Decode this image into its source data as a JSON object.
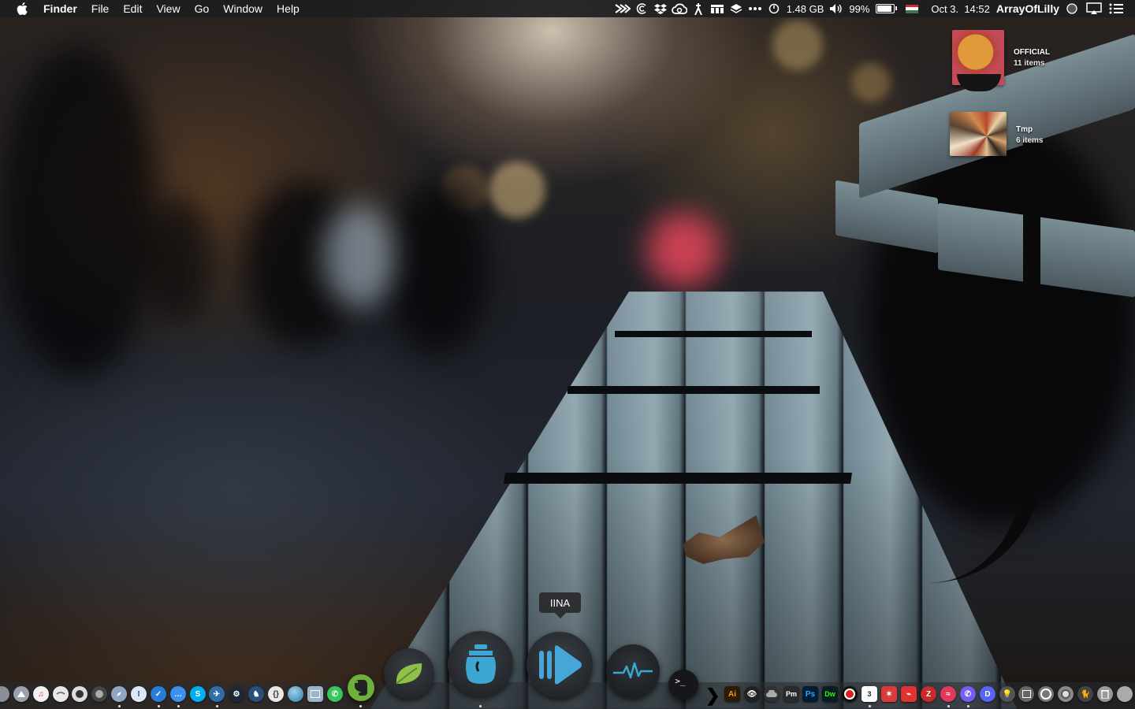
{
  "menubar": {
    "app_name": "Finder",
    "menus": [
      "File",
      "Edit",
      "View",
      "Go",
      "Window",
      "Help"
    ],
    "memory": "1.48 GB",
    "battery_percent": "99%",
    "battery_level": 0.99,
    "datetime": "Oct 3.  14:52",
    "user": "ArrayOfLilly"
  },
  "desktop": {
    "items": [
      {
        "name": "OFFICIAL",
        "subtitle": "11 items"
      },
      {
        "name": "Tmp",
        "subtitle": "6 items"
      }
    ]
  },
  "dock": {
    "tooltip": "IINA",
    "terminal_glyph": ">_",
    "divider_glyph": "❯",
    "right_labels": {
      "illustrator": "Ai",
      "phpmyadmin": "Pm",
      "photoshop": "Ps",
      "dreamweaver": "Dw",
      "calendar_day": "3"
    }
  },
  "colors": {
    "menubar_bg": "#1e1e20",
    "evernote": "#6fb03c",
    "iina": "#47a6d8"
  }
}
